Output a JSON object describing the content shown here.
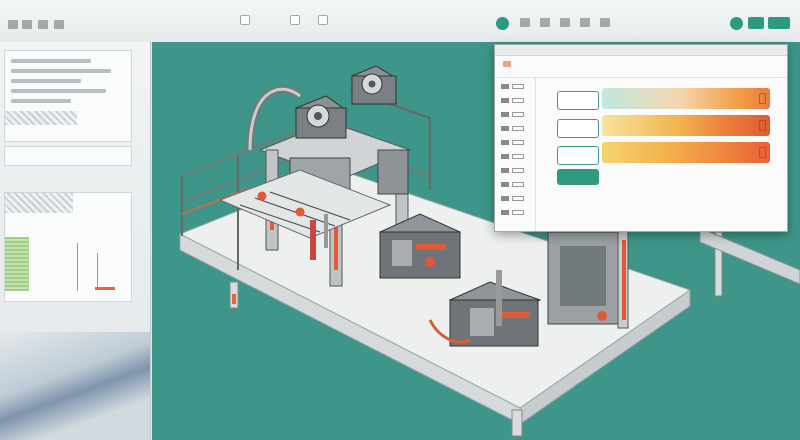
{
  "toolbar": {
    "title": ""
  },
  "colors": {
    "canvas": "#3d9689",
    "accent": "#2a9a80",
    "warn": "#e8643a"
  },
  "machine": {
    "icons": [
      "fan-unit-icon",
      "fan-unit-icon",
      "conveyor-arm-icon",
      "actuator-icon"
    ]
  },
  "panel": {
    "tabs": [
      "",
      ""
    ],
    "rows": [
      {
        "type": "teal-to-orange"
      },
      {
        "type": "yellow-to-red"
      },
      {
        "type": "yellow-to-orange"
      }
    ],
    "note": "",
    "footer": ""
  }
}
